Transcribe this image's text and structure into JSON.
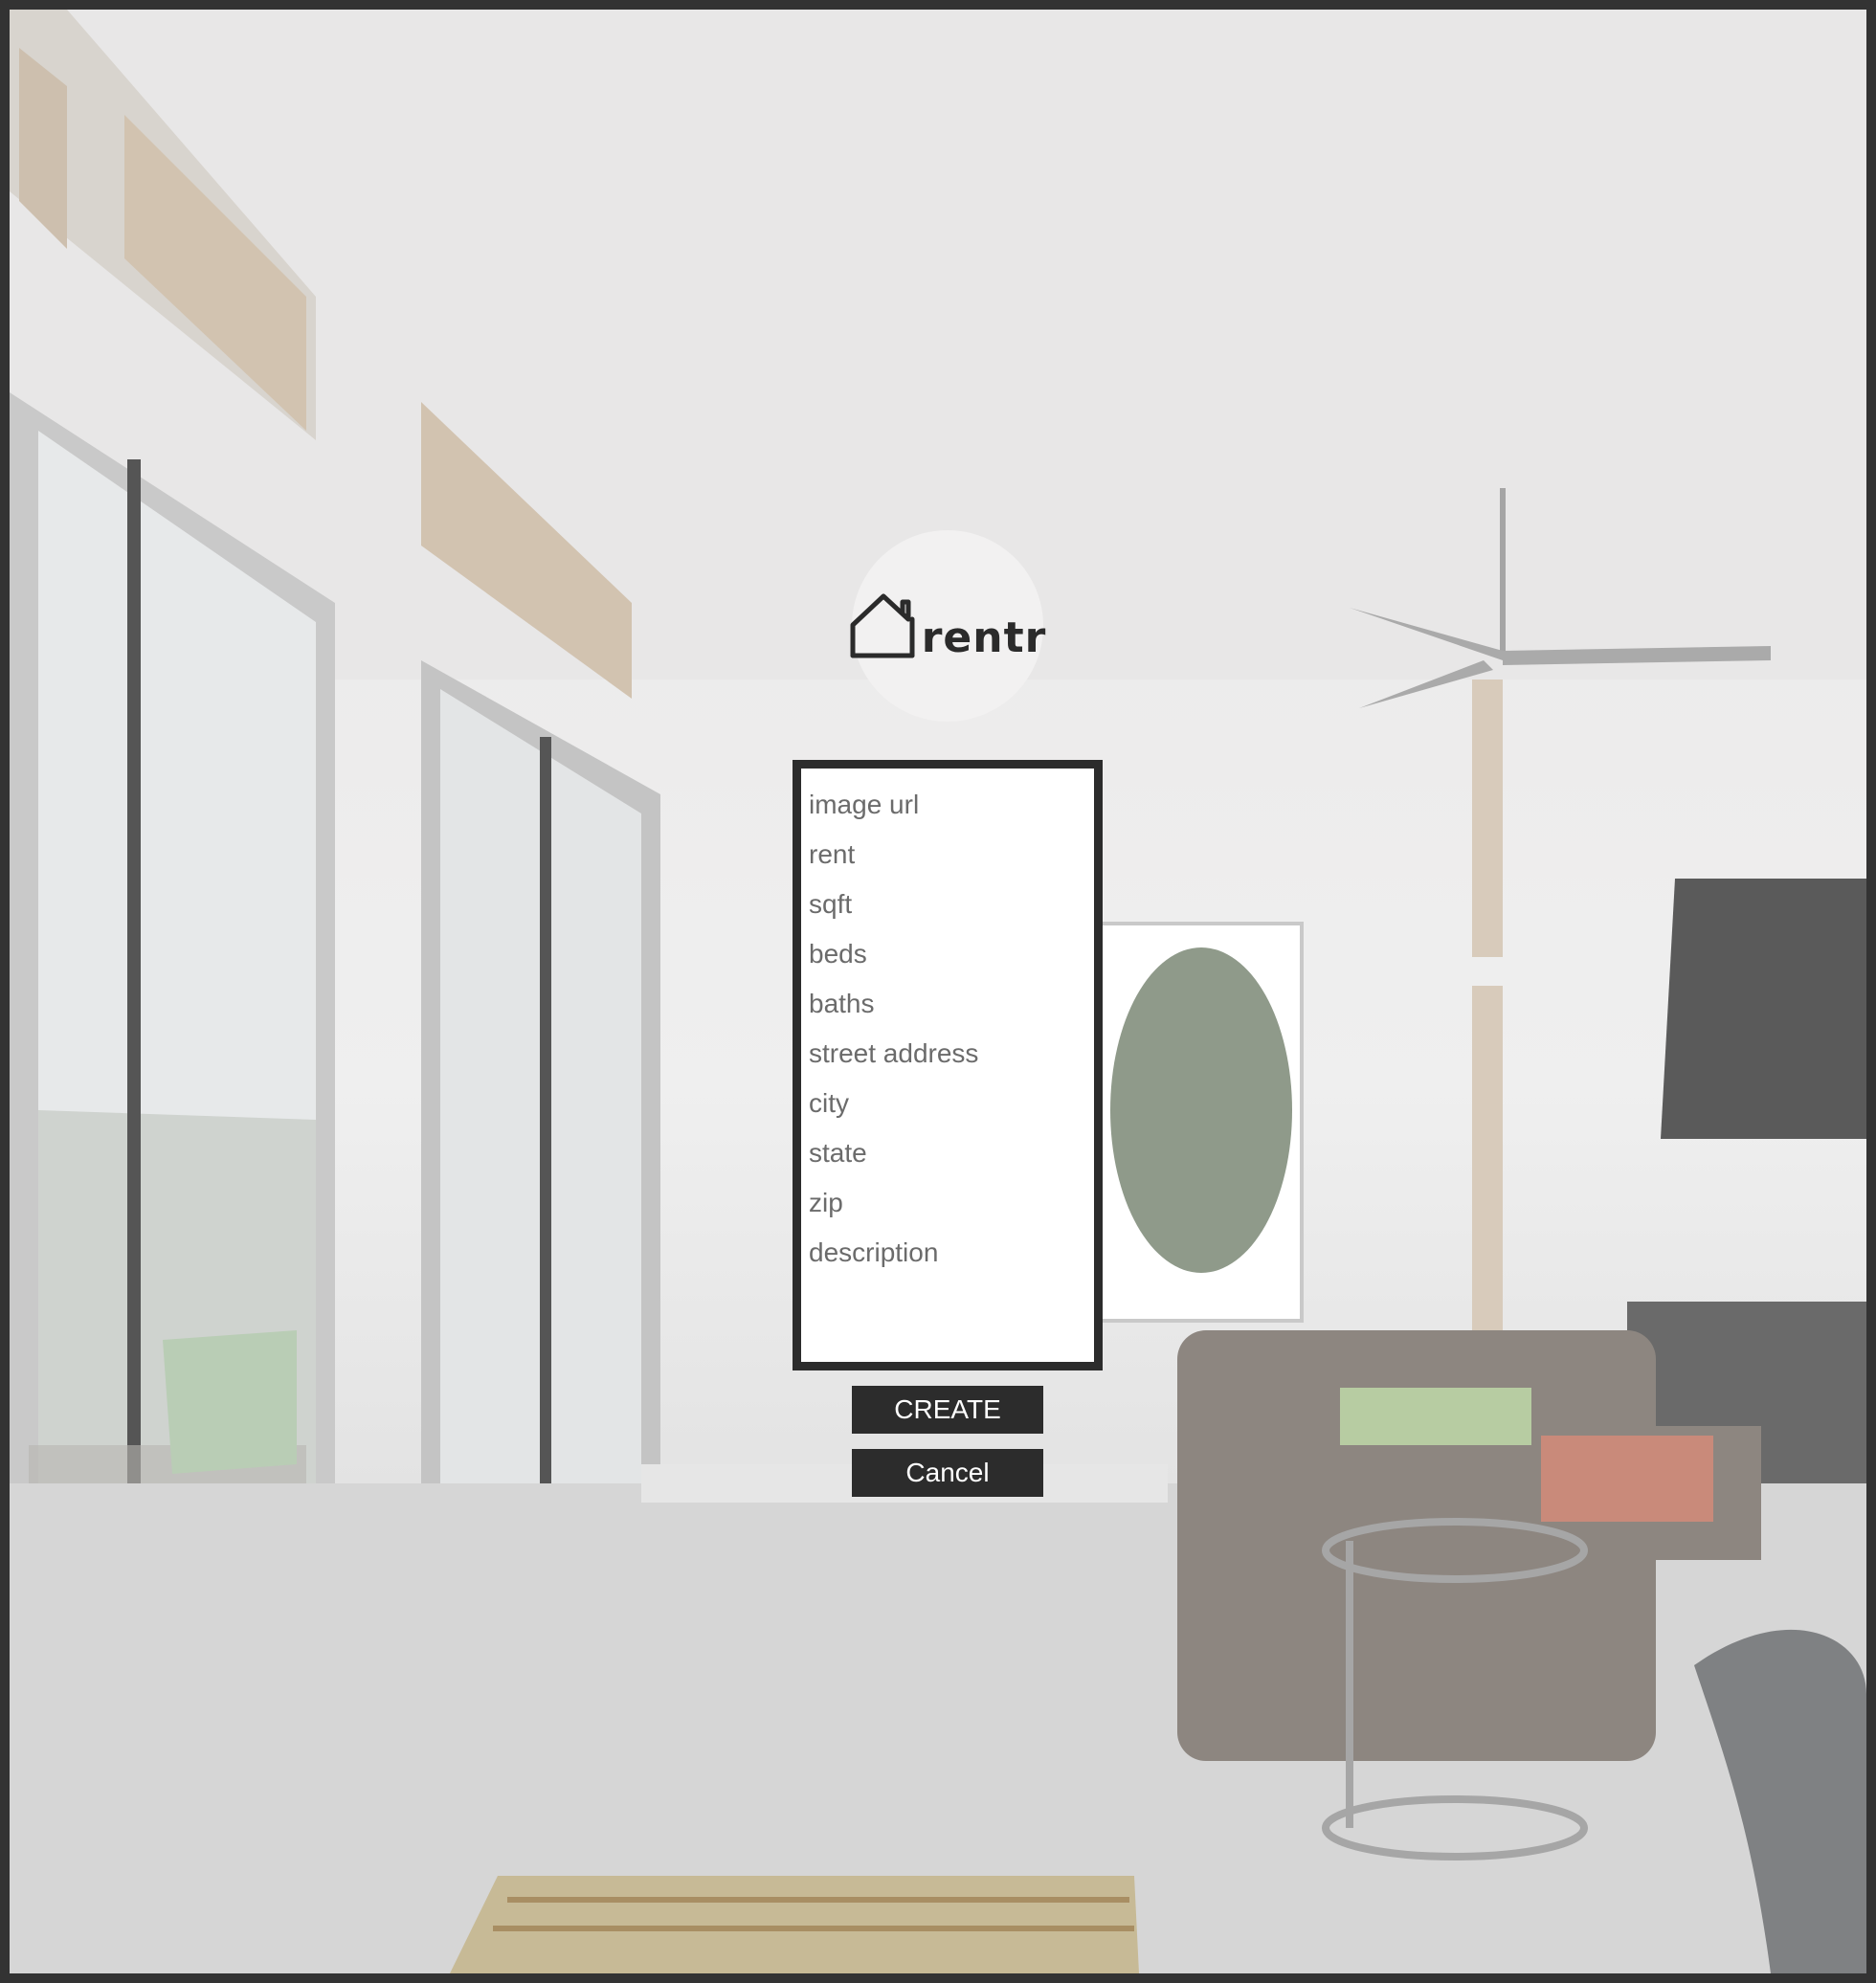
{
  "brand": {
    "logo_text": "rentr",
    "logo_icon": "house-outline-icon"
  },
  "form": {
    "fields": [
      {
        "name": "image_url",
        "placeholder": "image url",
        "value": ""
      },
      {
        "name": "rent",
        "placeholder": "rent",
        "value": ""
      },
      {
        "name": "sqft",
        "placeholder": "sqft",
        "value": ""
      },
      {
        "name": "beds",
        "placeholder": "beds",
        "value": ""
      },
      {
        "name": "baths",
        "placeholder": "baths",
        "value": ""
      },
      {
        "name": "street_address",
        "placeholder": "street address",
        "value": ""
      },
      {
        "name": "city",
        "placeholder": "city",
        "value": ""
      },
      {
        "name": "state",
        "placeholder": "state",
        "value": ""
      },
      {
        "name": "zip",
        "placeholder": "zip",
        "value": ""
      },
      {
        "name": "description",
        "placeholder": "description",
        "value": ""
      }
    ]
  },
  "buttons": {
    "create_label": "CREATE",
    "cancel_label": "Cancel"
  },
  "colors": {
    "frame": "#333333",
    "form_border": "#2c2c2c",
    "button_bg": "#2c2c2c",
    "button_text": "#ffffff",
    "logo_bg": "#f2f1f1"
  }
}
